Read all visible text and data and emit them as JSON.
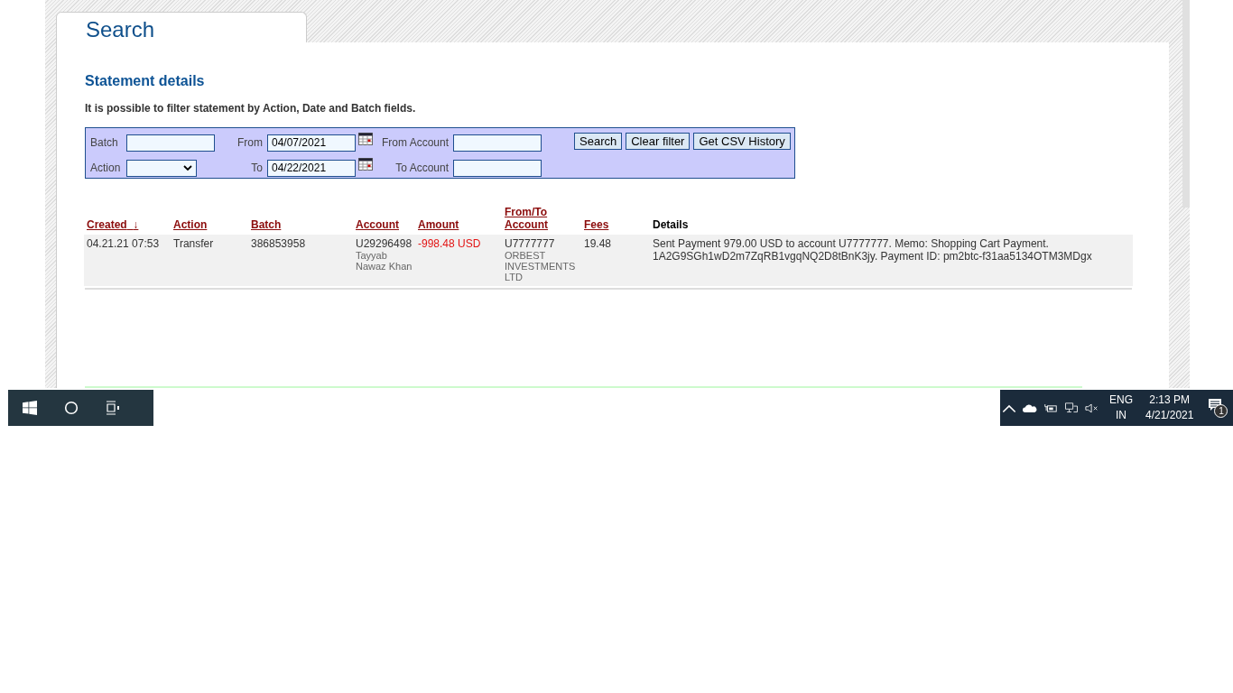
{
  "page": {
    "tab_title": "Search",
    "heading": "Statement details",
    "intro": "It is possible to filter statement by Action, Date and Batch fields."
  },
  "filter": {
    "batch_label": "Batch",
    "action_label": "Action",
    "from_label": "From",
    "from_value": "04/07/2021",
    "to_label": "To",
    "to_value": "04/22/2021",
    "from_account_label": "From Account",
    "to_account_label": "To Account",
    "buttons": [
      "Search",
      "Clear filter",
      "Get CSV History"
    ]
  },
  "table": {
    "columns": [
      {
        "label": "Created",
        "kind": "link",
        "sort_indicator": "↓"
      },
      {
        "label": "Action",
        "kind": "link"
      },
      {
        "label": "Batch",
        "kind": "link"
      },
      {
        "label": "Account",
        "kind": "link"
      },
      {
        "label": "Amount",
        "kind": "link"
      },
      {
        "label": "From/To Account",
        "kind": "link"
      },
      {
        "label": "Fees",
        "kind": "link"
      },
      {
        "label": "Details",
        "kind": "plain"
      }
    ],
    "rows": [
      {
        "created": "04.21.21 07:53",
        "action": "Transfer",
        "batch": "386853958",
        "account": "U29296498",
        "account_name": "Tayyab Nawaz Khan",
        "amount": "-998.48 USD",
        "negative": true,
        "from_to": "U7777777",
        "from_to_name": "ORBEST INVESTMENTS LTD",
        "fees": "19.48",
        "details": "Sent Payment 979.00 USD to account U7777777. Memo: Shopping Cart Payment. 1A2G9SGh1wD2m7ZqRB1vgqNQ2D8tBnK3jy. Payment ID: pm2btc-f31aa5134OTM3MDgx"
      }
    ]
  },
  "taskbar": {
    "language": "ENG",
    "region": "IN",
    "time": "2:13 PM",
    "date": "4/21/2021",
    "notifications": "1"
  }
}
